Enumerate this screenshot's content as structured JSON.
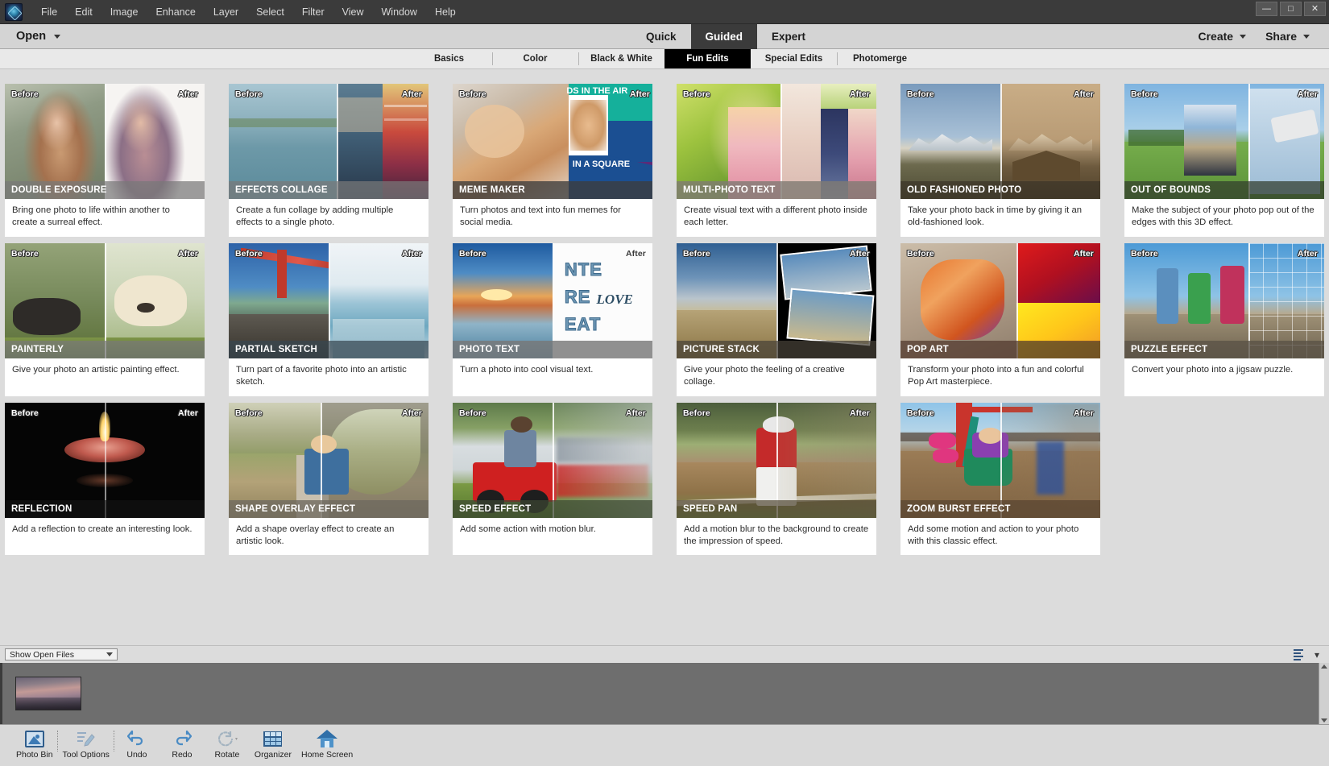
{
  "window": {
    "minimize_label": "—",
    "maximize_label": "□",
    "close_label": "✕"
  },
  "menubar": {
    "logo_name": "photoshop-elements-logo",
    "items": [
      "File",
      "Edit",
      "Image",
      "Enhance",
      "Layer",
      "Select",
      "Filter",
      "View",
      "Window",
      "Help"
    ]
  },
  "modebar": {
    "open_label": "Open",
    "modes": [
      {
        "label": "Quick",
        "active": false
      },
      {
        "label": "Guided",
        "active": true
      },
      {
        "label": "Expert",
        "active": false
      }
    ],
    "create_label": "Create",
    "share_label": "Share"
  },
  "subtabs": [
    {
      "label": "Basics",
      "active": false
    },
    {
      "label": "Color",
      "active": false
    },
    {
      "label": "Black & White",
      "active": false
    },
    {
      "label": "Fun Edits",
      "active": true
    },
    {
      "label": "Special Edits",
      "active": false
    },
    {
      "label": "Photomerge",
      "active": false
    }
  ],
  "card_labels": {
    "before": "Before",
    "after": "After"
  },
  "cards": [
    {
      "title": "DOUBLE EXPOSURE",
      "desc": "Bring one photo to life within another to create a surreal effect."
    },
    {
      "title": "EFFECTS COLLAGE",
      "desc": "Create a fun collage by adding multiple effects to a single photo."
    },
    {
      "title": "MEME MAKER",
      "desc": "Turn photos and text into fun memes for social media.",
      "overlay_top": "DS IN THE AIR",
      "overlay_bottom": "IN A SQUARE"
    },
    {
      "title": "MULTI-PHOTO TEXT",
      "desc": "Create visual text with a different photo inside each letter."
    },
    {
      "title": "OLD FASHIONED PHOTO",
      "desc": "Take your photo back in time by giving it an old-fashioned look."
    },
    {
      "title": "OUT OF BOUNDS",
      "desc": "Make the subject of your photo pop out of the edges with this 3D effect."
    },
    {
      "title": "PAINTERLY",
      "desc": "Give your photo an artistic painting effect."
    },
    {
      "title": "PARTIAL SKETCH",
      "desc": "Turn part of a favorite photo into an artistic sketch."
    },
    {
      "title": "PHOTO TEXT",
      "desc": "Turn a photo into cool visual text.",
      "overlay_top": "NTE",
      "overlay_mid": "RE",
      "overlay_script": "LOVE",
      "overlay_bottom": "EAT"
    },
    {
      "title": "PICTURE STACK",
      "desc": "Give your photo the feeling of a creative collage."
    },
    {
      "title": "POP ART",
      "desc": "Transform your photo into a fun and colorful Pop Art masterpiece."
    },
    {
      "title": "PUZZLE EFFECT",
      "desc": "Convert your photo into a jigsaw puzzle."
    },
    {
      "title": "REFLECTION",
      "desc": "Add a reflection to create an interesting look."
    },
    {
      "title": "SHAPE OVERLAY EFFECT",
      "desc": "Add a shape overlay effect to create an artistic look."
    },
    {
      "title": "SPEED EFFECT",
      "desc": "Add some action with motion blur."
    },
    {
      "title": "SPEED PAN",
      "desc": "Add a motion blur to the background to create the impression of speed."
    },
    {
      "title": "ZOOM BURST EFFECT",
      "desc": "Add some motion and action to your photo with this classic effect."
    }
  ],
  "photo_bin": {
    "filter_label": "Show Open Files",
    "thumbnail_name": "harbor-sunset-thumbnail"
  },
  "toolbar": [
    {
      "label": "Photo Bin",
      "icon": "photo-bin-icon",
      "disabled": false
    },
    {
      "label": "Tool Options",
      "icon": "tool-options-icon",
      "disabled": true
    },
    {
      "label": "Undo",
      "icon": "undo-icon",
      "disabled": false
    },
    {
      "label": "Redo",
      "icon": "redo-icon",
      "disabled": false
    },
    {
      "label": "Rotate",
      "icon": "rotate-icon",
      "disabled": true
    },
    {
      "label": "Organizer",
      "icon": "organizer-icon",
      "disabled": false
    },
    {
      "label": "Home Screen",
      "icon": "home-screen-icon",
      "disabled": false
    }
  ],
  "colors": {
    "menubar_bg": "#3b3b3b",
    "modebar_bg": "#d4d4d4",
    "active_tab_bg": "#000000",
    "workarea_bg": "#dcdcdc",
    "photobin_bg": "#6e6e6e",
    "card_bg": "#ffffff"
  }
}
